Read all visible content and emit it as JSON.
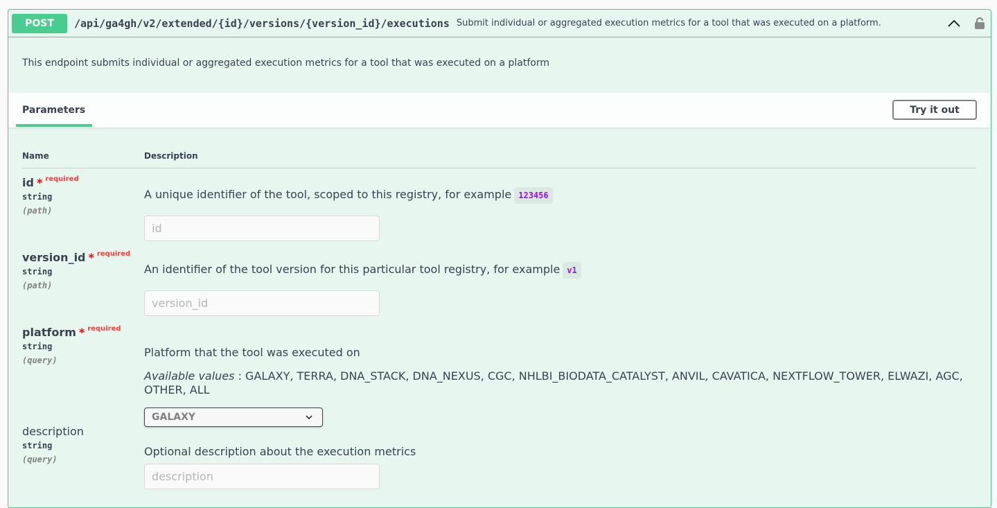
{
  "operation": {
    "method": "POST",
    "path": "/api/ga4gh/v2/extended/{id}/versions/{version_id}/executions",
    "summary": "Submit individual or aggregated execution metrics for a tool that was executed on a platform.",
    "description": "This endpoint submits individual or aggregated execution metrics for a tool that was executed on a platform",
    "color": "#49cc90"
  },
  "tabs": {
    "parameters": "Parameters",
    "try_it_out": "Try it out"
  },
  "table": {
    "name_header": "Name",
    "description_header": "Description"
  },
  "params": [
    {
      "name": "id",
      "required_star": "*",
      "required": "required",
      "type": "string",
      "in": "(path)",
      "description": "A unique identifier of the tool, scoped to this registry, for example",
      "example": "123456",
      "placeholder": "id"
    },
    {
      "name": "version_id",
      "required_star": "*",
      "required": "required",
      "type": "string",
      "in": "(path)",
      "description": "An identifier of the tool version for this particular tool registry, for example",
      "example": "v1",
      "placeholder": "version_id"
    },
    {
      "name": "platform",
      "required_star": "*",
      "required": "required",
      "type": "string",
      "in": "(query)",
      "description": "Platform that the tool was executed on",
      "available_label": "Available values",
      "available_values": ": GALAXY, TERRA, DNA_STACK, DNA_NEXUS, CGC, NHLBI_BIODATA_CATALYST, ANVIL, CAVATICA, NEXTFLOW_TOWER, ELWAZI, AGC, OTHER, ALL",
      "selected": "GALAXY"
    },
    {
      "name": "description",
      "type": "string",
      "in": "(query)",
      "description": "Optional description about the execution metrics",
      "placeholder": "description"
    }
  ]
}
